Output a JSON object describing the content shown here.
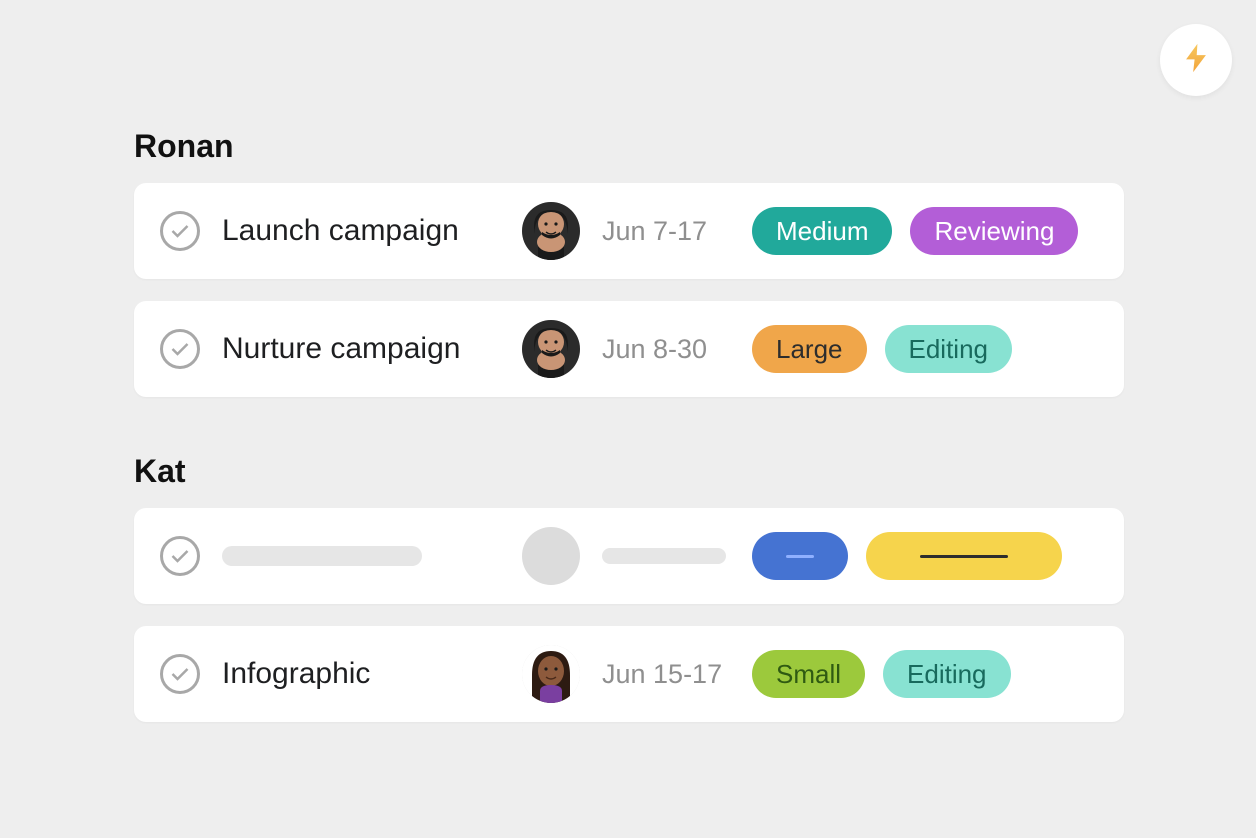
{
  "fab_icon": "bolt-icon",
  "colors": {
    "teal": "#21a99b",
    "purple": "#b35ed7",
    "orange": "#f0a64a",
    "aqua": "#88e2d2",
    "blue": "#4573d2",
    "yellow": "#f6d44c",
    "green": "#9cc93c"
  },
  "sections": [
    {
      "name": "Ronan",
      "tasks": [
        {
          "placeholder": false,
          "title": "Launch campaign",
          "assignee": "ronan",
          "date": "Jun 7-17",
          "pills": [
            {
              "label": "Medium",
              "bg": "#21a99b",
              "fg": "#ffffff"
            },
            {
              "label": "Reviewing",
              "bg": "#b35ed7",
              "fg": "#ffffff"
            }
          ]
        },
        {
          "placeholder": false,
          "title": "Nurture campaign",
          "assignee": "ronan",
          "date": "Jun 8-30",
          "pills": [
            {
              "label": "Large",
              "bg": "#f0a64a",
              "fg": "#2d2d2d"
            },
            {
              "label": "Editing",
              "bg": "#88e2d2",
              "fg": "#186a5d"
            }
          ]
        }
      ]
    },
    {
      "name": "Kat",
      "tasks": [
        {
          "placeholder": true,
          "pills": [
            {
              "bg": "#4573d2",
              "line": "#8fb0ff"
            },
            {
              "bg": "#f6d44c",
              "line": "#2d2d2d",
              "wide": true
            }
          ]
        },
        {
          "placeholder": false,
          "title": "Infographic",
          "assignee": "kat",
          "date": "Jun 15-17",
          "pills": [
            {
              "label": "Small",
              "bg": "#9cc93c",
              "fg": "#2f5a12"
            },
            {
              "label": "Editing",
              "bg": "#88e2d2",
              "fg": "#186a5d"
            }
          ]
        }
      ]
    }
  ]
}
